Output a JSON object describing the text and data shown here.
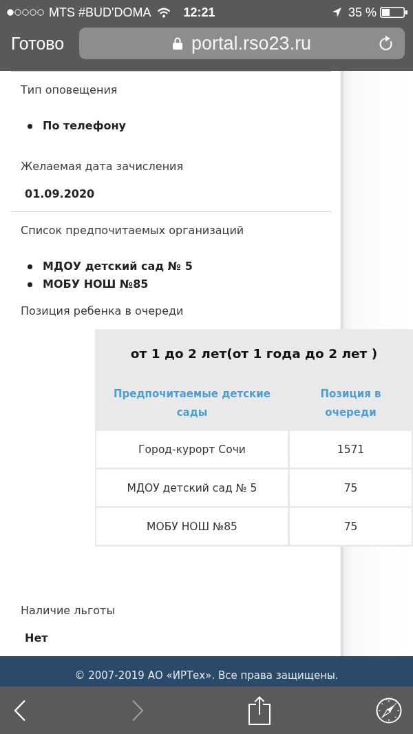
{
  "status_bar": {
    "carrier": "MTS #BUD'DOMA",
    "time": "12:21",
    "battery": "35 %"
  },
  "browser_bar": {
    "done_button": "Готово",
    "url": "portal.rso23.ru"
  },
  "sections": [
    {
      "fields": [
        {
          "kind": "list",
          "label": "Тип оповещения",
          "items": [
            "По телефону"
          ]
        },
        {
          "kind": "text",
          "label": "Желаемая дата зачисления",
          "value": "01.09.2020"
        }
      ]
    },
    {
      "fields": [
        {
          "kind": "list",
          "label": "Список предпочитаемых организаций",
          "items": [
            "МДОУ детский сад № 5",
            "МОБУ НОШ №85"
          ]
        },
        {
          "kind": "table",
          "label": "Позиция ребенка в очереди",
          "table": {
            "title": "от 1 до 2 лет(от 1 года до 2 лет )",
            "columns": [
              "Предпочитаемые детские сады",
              "Позиция в очереди"
            ],
            "rows": [
              [
                "Город-курорт Сочи",
                "1571"
              ],
              [
                "МДОУ детский сад № 5",
                "75"
              ],
              [
                "МОБУ НОШ №85",
                "75"
              ]
            ]
          }
        },
        {
          "kind": "text",
          "label": "Наличие льготы",
          "value": "Нет"
        }
      ]
    }
  ],
  "footer": {
    "copyright": "© 2007-2019 АО «ИРТех». Все права защищены."
  },
  "toolbar": [
    {
      "kind": "back",
      "disabled": false
    },
    {
      "kind": "forward",
      "disabled": true
    },
    {
      "kind": "share",
      "disabled": false
    },
    {
      "kind": "compass",
      "disabled": false
    }
  ]
}
